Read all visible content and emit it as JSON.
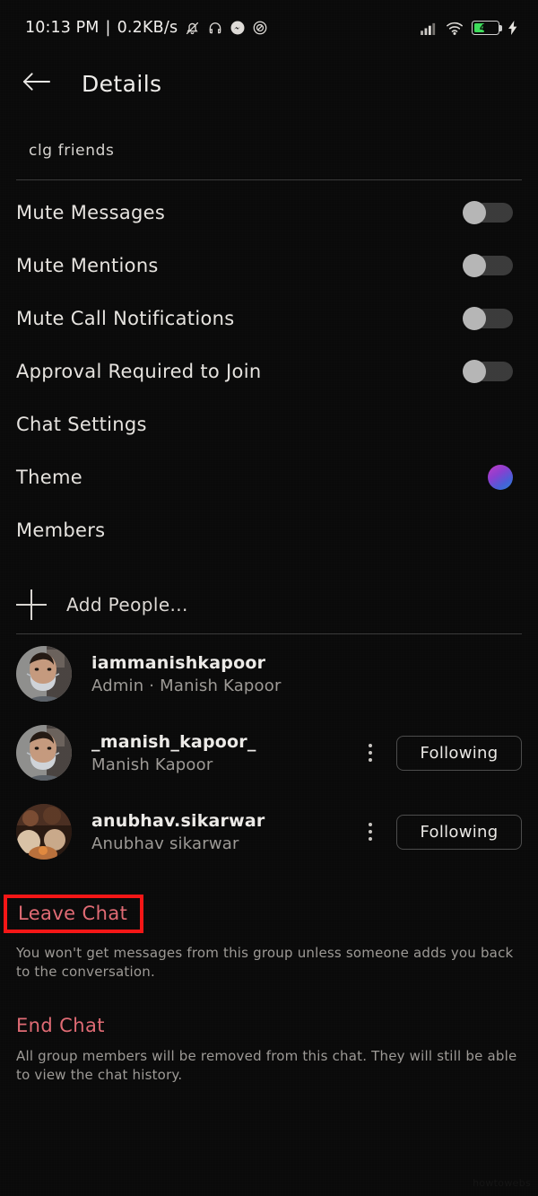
{
  "statusbar": {
    "clock": "10:13 PM",
    "separator": "|",
    "network_speed": "0.2KB/s",
    "left_icons": [
      "bell-muted-icon",
      "headphones-icon",
      "messenger-icon",
      "dnd-icon"
    ],
    "signal": "signal-bars-icon",
    "wifi": "wifi-icon",
    "battery_percent": "45",
    "battery_level": 45,
    "charging": true,
    "battery_color": "#3ddc5a"
  },
  "header": {
    "back_icon": "back-arrow-icon",
    "title": "Details"
  },
  "group": {
    "name": "clg friends"
  },
  "settings": [
    {
      "label": "Mute Messages",
      "control": "toggle",
      "value": false
    },
    {
      "label": "Mute Mentions",
      "control": "toggle",
      "value": false
    },
    {
      "label": "Mute Call Notifications",
      "control": "toggle",
      "value": false
    },
    {
      "label": "Approval Required to Join",
      "control": "toggle",
      "value": false
    },
    {
      "label": "Chat Settings",
      "control": "none",
      "value": null
    },
    {
      "label": "Theme",
      "control": "color-dot",
      "value": "#9b3fd0"
    },
    {
      "label": "Members",
      "control": "none",
      "value": null
    }
  ],
  "add_people": {
    "icon": "plus-icon",
    "label": "Add People..."
  },
  "members": [
    {
      "username": "iammanishkapoor",
      "subtitle": "Admin · Manish Kapoor",
      "avatar": "photo-man-mask",
      "has_kebab": false,
      "action_label": null
    },
    {
      "username": "_manish_kapoor_",
      "subtitle": "Manish Kapoor",
      "avatar": "photo-man-mask",
      "has_kebab": true,
      "action_label": "Following"
    },
    {
      "username": "anubhav.sikarwar",
      "subtitle": "Anubhav sikarwar",
      "avatar": "photo-group-warm",
      "has_kebab": true,
      "action_label": "Following"
    }
  ],
  "leave_chat": {
    "title": "Leave Chat",
    "description": "You won't get messages from this group unless someone adds you back to the conversation.",
    "highlight_color": "#f51616",
    "text_color": "#e06b74"
  },
  "end_chat": {
    "title": "End Chat",
    "description": "All group members will be removed from this chat. They will still be able to view the chat history.",
    "text_color": "#e06b74"
  },
  "watermark": "howtowebs"
}
